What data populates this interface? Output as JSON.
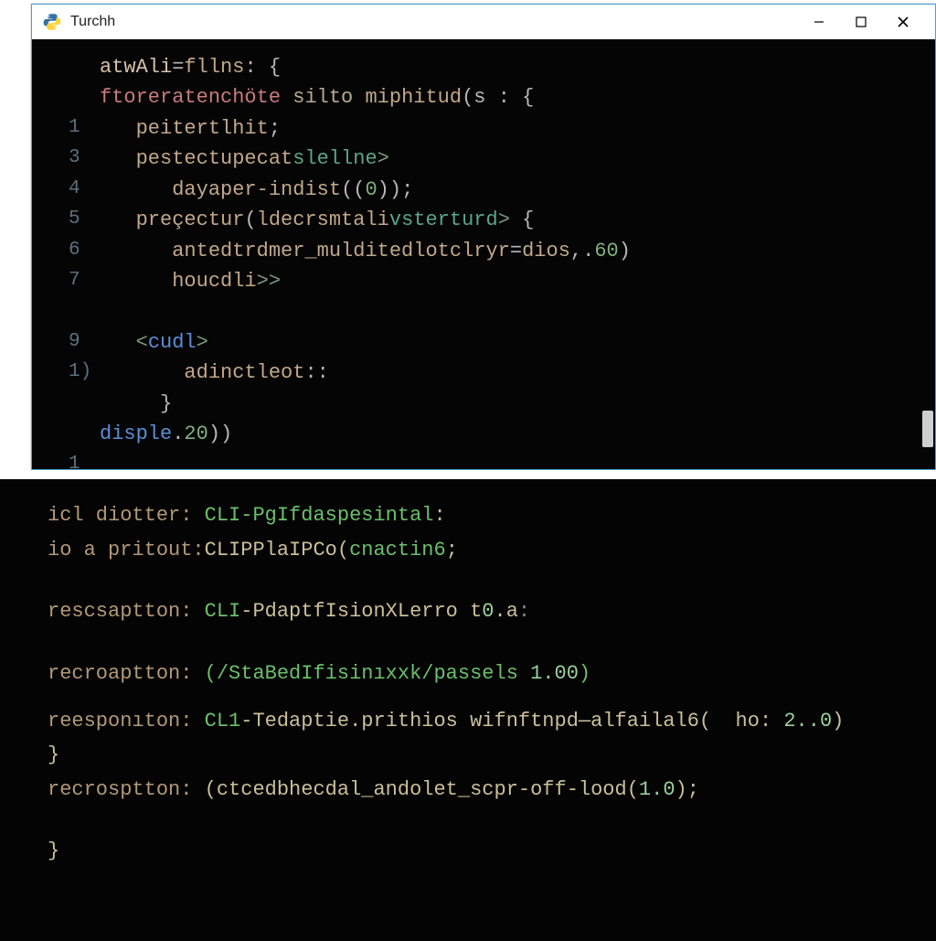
{
  "window": {
    "title": "Turchh",
    "minimize_label": "Minimize",
    "maximize_label": "Maximize",
    "close_label": "Close"
  },
  "editor": {
    "lines": [
      {
        "gutter": "",
        "segments": [
          {
            "c": "tok-var",
            "t": "atwAli"
          },
          {
            "c": "tok-punc",
            "t": "="
          },
          {
            "c": "tok-id",
            "t": "fllns"
          },
          {
            "c": "tok-punc",
            "t": ": {"
          }
        ]
      },
      {
        "gutter": "",
        "segments": [
          {
            "c": "tok-kw",
            "t": "ftoreratenchöte"
          },
          {
            "c": "tok-plain",
            "t": " silto "
          },
          {
            "c": "tok-id",
            "t": "miphitud"
          },
          {
            "c": "tok-punc",
            "t": "(s : {"
          }
        ]
      },
      {
        "gutter": "1",
        "segments": [
          {
            "c": "tok-plain",
            "t": "   "
          },
          {
            "c": "tok-id",
            "t": "peitertlhit"
          },
          {
            "c": "tok-punc",
            "t": ";"
          }
        ]
      },
      {
        "gutter": "3",
        "segments": [
          {
            "c": "tok-plain",
            "t": "   "
          },
          {
            "c": "tok-id",
            "t": "pestectupecat"
          },
          {
            "c": "tok-fn",
            "t": "slellne"
          },
          {
            "c": "tok-lt",
            "t": ">"
          }
        ]
      },
      {
        "gutter": "4",
        "segments": [
          {
            "c": "tok-plain",
            "t": "      "
          },
          {
            "c": "tok-id",
            "t": "dayaper-indist"
          },
          {
            "c": "tok-punc",
            "t": "(("
          },
          {
            "c": "tok-num",
            "t": "0"
          },
          {
            "c": "tok-punc",
            "t": "));"
          }
        ]
      },
      {
        "gutter": "5",
        "segments": [
          {
            "c": "tok-plain",
            "t": "   "
          },
          {
            "c": "tok-id",
            "t": "preçectur"
          },
          {
            "c": "tok-punc",
            "t": "("
          },
          {
            "c": "tok-id",
            "t": "ldecrsmtali"
          },
          {
            "c": "tok-fn",
            "t": "vsterturd"
          },
          {
            "c": "tok-lt",
            "t": "> "
          },
          {
            "c": "tok-punc",
            "t": "{"
          }
        ]
      },
      {
        "gutter": "6",
        "segments": [
          {
            "c": "tok-plain",
            "t": "      "
          },
          {
            "c": "tok-id",
            "t": "antedtrdmer_mulditedlotclryr"
          },
          {
            "c": "tok-punc",
            "t": "="
          },
          {
            "c": "tok-id",
            "t": "dios"
          },
          {
            "c": "tok-punc",
            "t": ",."
          },
          {
            "c": "tok-num",
            "t": "60"
          },
          {
            "c": "tok-punc",
            "t": ")"
          }
        ]
      },
      {
        "gutter": "7",
        "segments": [
          {
            "c": "tok-plain",
            "t": "      "
          },
          {
            "c": "tok-id",
            "t": "houcdli"
          },
          {
            "c": "tok-lt",
            "t": ">>"
          }
        ]
      },
      {
        "gutter": "",
        "segments": [
          {
            "c": "tok-plain",
            "t": " "
          }
        ]
      },
      {
        "gutter": "9",
        "segments": [
          {
            "c": "tok-plain",
            "t": "   "
          },
          {
            "c": "tok-lt",
            "t": "<"
          },
          {
            "c": "tok-kw2",
            "t": "cudl"
          },
          {
            "c": "tok-lt",
            "t": ">"
          }
        ]
      },
      {
        "gutter": "1)",
        "segments": [
          {
            "c": "tok-plain",
            "t": "       "
          },
          {
            "c": "tok-id",
            "t": "adinctleot"
          },
          {
            "c": "tok-punc",
            "t": "::"
          }
        ]
      },
      {
        "gutter": "",
        "segments": [
          {
            "c": "tok-plain",
            "t": "     "
          },
          {
            "c": "tok-punc",
            "t": "}"
          }
        ]
      },
      {
        "gutter": "",
        "segments": [
          {
            "c": "tok-kw2",
            "t": "disple"
          },
          {
            "c": "tok-punc",
            "t": "."
          },
          {
            "c": "tok-num",
            "t": "20"
          },
          {
            "c": "tok-punc",
            "t": "))"
          }
        ]
      },
      {
        "gutter": "1",
        "segments": [
          {
            "c": "tok-dim",
            "t": ""
          }
        ]
      }
    ]
  },
  "terminal": {
    "lines": [
      {
        "segments": [
          {
            "c": "t-label",
            "t": "icl diotter: "
          },
          {
            "c": "t-green",
            "t": "CLI-PgIfdaspesintal"
          },
          {
            "c": "t-cream",
            "t": ":"
          }
        ]
      },
      {
        "segments": [
          {
            "c": "t-label",
            "t": "io a pritout:"
          },
          {
            "c": "t-cream",
            "t": "CLIPPlaIPCo("
          },
          {
            "c": "t-green",
            "t": "cnactin6"
          },
          {
            "c": "t-cream",
            "t": ";"
          }
        ]
      },
      {
        "spacer": true
      },
      {
        "segments": [
          {
            "c": "t-label",
            "t": "rescsaptton: "
          },
          {
            "c": "t-green",
            "t": "CLI"
          },
          {
            "c": "t-cream",
            "t": "-PdaptfIsionXLerro "
          },
          {
            "c": "t-cream",
            "t": "t"
          },
          {
            "c": "t-num",
            "t": "0"
          },
          {
            "c": "t-cream",
            "t": ".a"
          },
          {
            "c": "t-dim",
            "t": ":"
          }
        ]
      },
      {
        "spacer": true
      },
      {
        "segments": [
          {
            "c": "t-label",
            "t": "recroaptton: "
          },
          {
            "c": "t-path",
            "t": "(/StaBedIfisinıxxk/passels "
          },
          {
            "c": "t-num",
            "t": "1.00"
          },
          {
            "c": "t-path",
            "t": ")"
          }
        ]
      },
      {
        "spacer_sm": true
      },
      {
        "segments": [
          {
            "c": "t-label",
            "t": "reesponıton: "
          },
          {
            "c": "t-green",
            "t": "CL1"
          },
          {
            "c": "t-cream",
            "t": "-Tedaptie.prithios wifnftnpd—alfailal6(  ho: "
          },
          {
            "c": "t-num",
            "t": "2..0"
          },
          {
            "c": "t-cream",
            "t": ")"
          }
        ]
      },
      {
        "segments": [
          {
            "c": "t-cream",
            "t": "}"
          }
        ]
      },
      {
        "segments": [
          {
            "c": "t-label",
            "t": "recrosptton: "
          },
          {
            "c": "t-cream",
            "t": "(ctcedbhecdal_andolet_scpr-off-lood("
          },
          {
            "c": "t-num",
            "t": "1.0"
          },
          {
            "c": "t-cream",
            "t": ");"
          }
        ]
      },
      {
        "spacer": true
      },
      {
        "segments": [
          {
            "c": "t-cream",
            "t": "}"
          }
        ]
      }
    ]
  }
}
